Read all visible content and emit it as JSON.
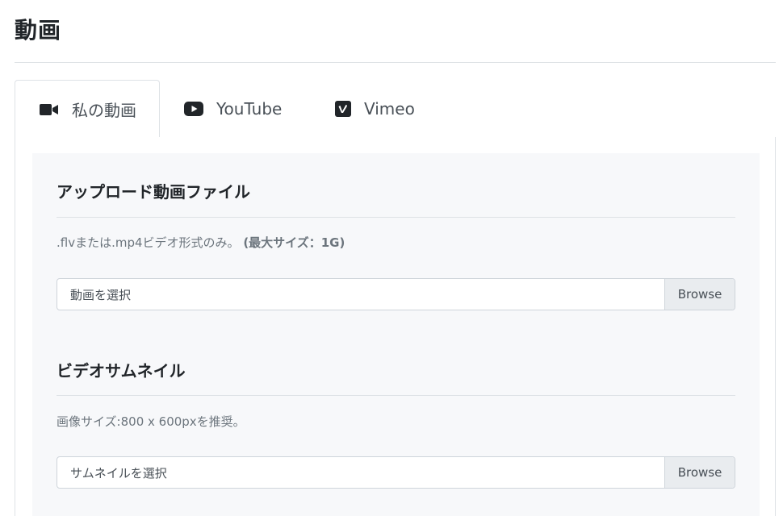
{
  "page": {
    "title": "動画"
  },
  "tabs": [
    {
      "label": "私の動画",
      "icon": "video-camera-icon",
      "active": true
    },
    {
      "label": "YouTube",
      "icon": "youtube-icon",
      "active": false
    },
    {
      "label": "Vimeo",
      "icon": "vimeo-icon",
      "active": false
    }
  ],
  "upload": {
    "title": "アップロード動画ファイル",
    "help": ".flvまたは.mp4ビデオ形式のみ。",
    "help_bold": "(最大サイズ：1G)",
    "placeholder": "動画を選択",
    "browse": "Browse"
  },
  "thumbnail": {
    "title": "ビデオサムネイル",
    "help": "画像サイズ:800 x 600pxを推奨。",
    "placeholder": "サムネイルを選択",
    "browse": "Browse"
  },
  "colors": {
    "accent": "#212529",
    "panel_bg": "#f7f8fa",
    "border": "#dee2e6",
    "browse_bg": "#e9ecef"
  }
}
